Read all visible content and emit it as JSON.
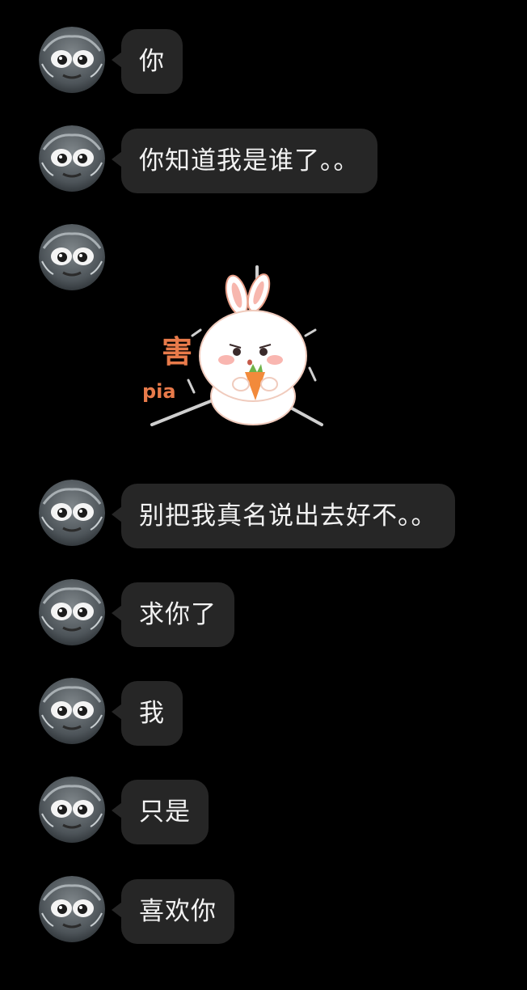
{
  "chat": {
    "messages": [
      {
        "type": "text",
        "text": "你"
      },
      {
        "type": "text",
        "text": "你知道我是谁了。。"
      },
      {
        "type": "sticker",
        "icon": "shy-bunny-carrot-sticker",
        "caption_char": "害",
        "caption_word": "pia"
      },
      {
        "type": "text",
        "text": "别把我真名说出去好不。。"
      },
      {
        "type": "text",
        "text": "求你了"
      },
      {
        "type": "text",
        "text": "我"
      },
      {
        "type": "text",
        "text": "只是"
      },
      {
        "type": "text",
        "text": "喜欢你"
      }
    ]
  },
  "theme": {
    "background": "#000000",
    "bubble": "#262626",
    "text": "#f2f2f2",
    "sticker_accent": "#e87a4a"
  }
}
